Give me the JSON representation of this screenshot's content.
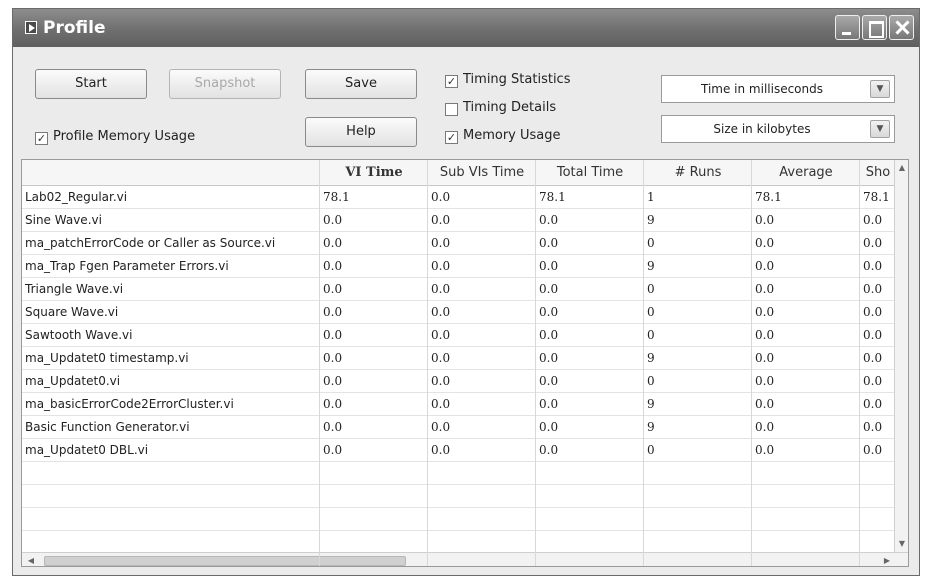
{
  "window": {
    "title": "Profile"
  },
  "controls": {
    "start_label": "Start",
    "snapshot_label": "Snapshot",
    "save_label": "Save",
    "help_label": "Help",
    "profile_memory_label": "Profile Memory Usage",
    "profile_memory_checked": true,
    "timing_statistics_label": "Timing Statistics",
    "timing_statistics_checked": true,
    "timing_details_label": "Timing Details",
    "timing_details_checked": false,
    "memory_usage_label": "Memory Usage",
    "memory_usage_checked": true,
    "time_unit_value": "Time in milliseconds",
    "size_unit_value": "Size in kilobytes"
  },
  "table": {
    "columns": [
      "",
      "VI Time",
      "Sub VIs Time",
      "Total Time",
      "# Runs",
      "Average",
      "Sho"
    ],
    "rows": [
      [
        "Lab02_Regular.vi",
        "78.1",
        "0.0",
        "78.1",
        "1",
        "78.1",
        "78.1"
      ],
      [
        "Sine Wave.vi",
        "0.0",
        "0.0",
        "0.0",
        "9",
        "0.0",
        "0.0"
      ],
      [
        "ma_patchErrorCode or Caller as Source.vi",
        "0.0",
        "0.0",
        "0.0",
        "0",
        "0.0",
        "0.0"
      ],
      [
        "ma_Trap Fgen Parameter Errors.vi",
        "0.0",
        "0.0",
        "0.0",
        "9",
        "0.0",
        "0.0"
      ],
      [
        "Triangle Wave.vi",
        "0.0",
        "0.0",
        "0.0",
        "0",
        "0.0",
        "0.0"
      ],
      [
        "Square Wave.vi",
        "0.0",
        "0.0",
        "0.0",
        "0",
        "0.0",
        "0.0"
      ],
      [
        "Sawtooth Wave.vi",
        "0.0",
        "0.0",
        "0.0",
        "0",
        "0.0",
        "0.0"
      ],
      [
        "ma_Updatet0 timestamp.vi",
        "0.0",
        "0.0",
        "0.0",
        "9",
        "0.0",
        "0.0"
      ],
      [
        "ma_Updatet0.vi",
        "0.0",
        "0.0",
        "0.0",
        "0",
        "0.0",
        "0.0"
      ],
      [
        "ma_basicErrorCode2ErrorCluster.vi",
        "0.0",
        "0.0",
        "0.0",
        "9",
        "0.0",
        "0.0"
      ],
      [
        "Basic Function Generator.vi",
        "0.0",
        "0.0",
        "0.0",
        "9",
        "0.0",
        "0.0"
      ],
      [
        "ma_Updatet0 DBL.vi",
        "0.0",
        "0.0",
        "0.0",
        "0",
        "0.0",
        "0.0"
      ]
    ],
    "empty_rows": 5
  }
}
